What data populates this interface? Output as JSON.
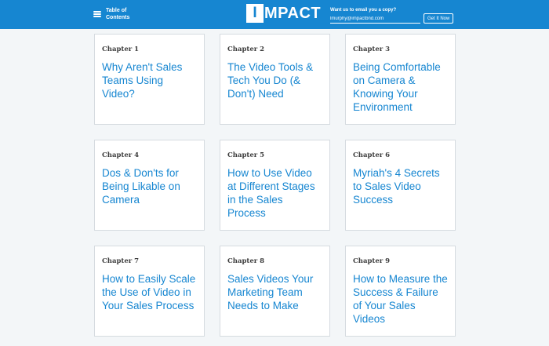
{
  "header": {
    "toc_label": "Table of Contents",
    "logo_box": "I",
    "logo_rest": "MPACT",
    "email_prompt": "Want us to email you a copy?",
    "email_value": "lmurphy@impactbnd.com",
    "cta_label": "Get It Now"
  },
  "chapters": [
    {
      "label": "Chapter 1",
      "title": "Why Aren't Sales Teams Using Video?"
    },
    {
      "label": "Chapter 2",
      "title": "The Video Tools & Tech You Do (& Don't) Need"
    },
    {
      "label": "Chapter 3",
      "title": "Being Comfortable on Camera & Knowing Your Environment"
    },
    {
      "label": "Chapter 4",
      "title": "Dos & Don'ts for Being Likable on Camera"
    },
    {
      "label": "Chapter 5",
      "title": "How to Use Video at Different Stages in the Sales Process"
    },
    {
      "label": "Chapter 6",
      "title": "Myriah's 4 Secrets to Sales Video Success"
    },
    {
      "label": "Chapter 7",
      "title": "How to Easily Scale the Use of Video in Your Sales Process"
    },
    {
      "label": "Chapter 8",
      "title": "Sales Videos Your Marketing Team Needs to Make"
    },
    {
      "label": "Chapter 9",
      "title": "How to Measure the Success & Failure of Your Sales Videos"
    }
  ],
  "colors": {
    "brand_blue": "#1686d1",
    "background": "#f3f6f8",
    "card_border": "#d6dbe0"
  }
}
